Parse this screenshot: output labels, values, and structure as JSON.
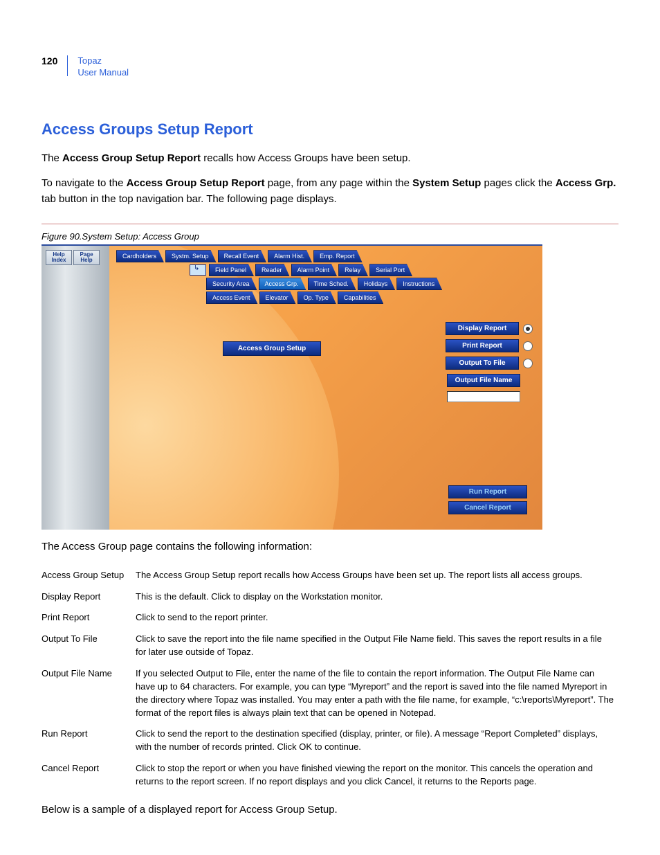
{
  "header": {
    "page_number": "120",
    "doc_title_line1": "Topaz",
    "doc_title_line2": "User Manual"
  },
  "section": {
    "title": "Access Groups Setup Report",
    "intro_prefix": "The ",
    "intro_bold1": "Access Group Setup Report",
    "intro_suffix": " recalls how Access Groups have been setup.",
    "nav_p1": "To navigate to the ",
    "nav_b1": "Access Group Setup Report",
    "nav_p2": " page, from any page within the ",
    "nav_b2": "System Setup",
    "nav_p3": " pages click the ",
    "nav_b3": "Access Grp.",
    "nav_p4": " tab button in the top navigation bar. The following page displays."
  },
  "figure": {
    "caption": "Figure 90.System Setup: Access Group",
    "help_btn": "Help Index",
    "page_help_btn": "Page Help",
    "tabs_row1": [
      "Cardholders",
      "Systm. Setup",
      "Recall Event",
      "Alarm Hist.",
      "Emp. Report"
    ],
    "tabs_row2": [
      "Field Panel",
      "Reader",
      "Alarm Point",
      "Relay",
      "Serial Port"
    ],
    "tabs_row3": [
      "Security Area",
      "Access Grp.",
      "Time Sched.",
      "Holidays",
      "Instructions"
    ],
    "tabs_row4": [
      "Access Event",
      "Elevator",
      "Op. Type",
      "Capabilities"
    ],
    "active_tab": "Access Grp.",
    "center_label": "Access Group Setup",
    "options": [
      {
        "label": "Display Report",
        "selected": true
      },
      {
        "label": "Print Report",
        "selected": false
      },
      {
        "label": "Output To File",
        "selected": false
      }
    ],
    "output_file_label": "Output File Name",
    "run_label": "Run Report",
    "cancel_label": "Cancel Report"
  },
  "after_figure": "The Access Group page contains the following information:",
  "definitions": [
    {
      "term": "Access Group Setup",
      "desc": "The Access Group Setup report recalls how Access Groups have been set up. The report lists all access groups."
    },
    {
      "term": "Display Report",
      "desc": "This is the default. Click to display on the Workstation monitor."
    },
    {
      "term": "Print Report",
      "desc": "Click to send to the report printer."
    },
    {
      "term": "Output To File",
      "desc": "Click to save the report into the file name specified in the Output File Name field. This saves the report results in a file for later use outside of Topaz."
    },
    {
      "term": "Output File Name",
      "desc": "If you selected Output to File, enter the name of the file to contain the report information. The Output File Name can have up to 64 characters. For example, you can type “Myreport” and the report is saved into the file named Myreport in the directory where Topaz was installed. You may enter a path with the file name, for example, “c:\\reports\\Myreport”. The format of the report files is always plain text that can be opened in Notepad."
    },
    {
      "term": "Run Report",
      "desc_pre": "Click to send the report to the destination specified (display, printer, or file). A message “Report Completed” displays, with the number of records printed. Click ",
      "desc_bold": "OK",
      "desc_post": " to continue."
    },
    {
      "term": "Cancel Report",
      "desc_pre": "Click to stop the report or when you have finished viewing the report on the monitor. This cancels the operation and returns to the report screen. If no report displays and you click ",
      "desc_bold": "Cancel,",
      "desc_post": " it returns to the Reports page."
    }
  ],
  "closing": "Below is a sample of a displayed report for Access Group Setup."
}
